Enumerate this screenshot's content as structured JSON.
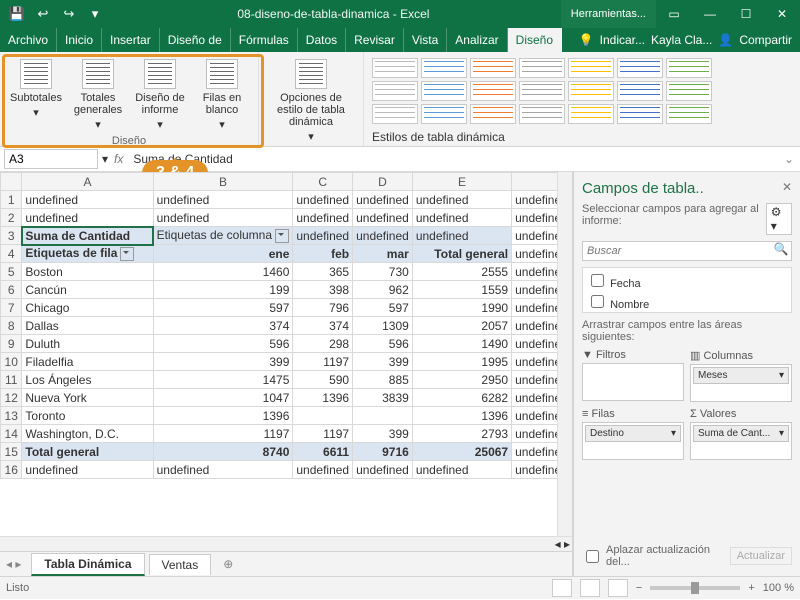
{
  "title": {
    "doc": "08-diseno-de-tabla-dinamica",
    "app": "Excel",
    "tools": "Herramientas..."
  },
  "menu": [
    "Archivo",
    "Inicio",
    "Insertar",
    "Diseño de",
    "Fórmulas",
    "Datos",
    "Revisar",
    "Vista",
    "Analizar",
    "Diseño"
  ],
  "menuActive": 9,
  "tell": "Indicar...",
  "user": "Kayla Cla...",
  "share": "Compartir",
  "ribbon": {
    "g1": {
      "items": [
        "Subtotales",
        "Totales generales",
        "Diseño de informe",
        "Filas en blanco"
      ],
      "label": "Diseño"
    },
    "g2": {
      "items": [
        "Opciones de estilo de tabla dinámica"
      ],
      "label": ""
    },
    "g3": {
      "label": "Estilos de tabla dinámica"
    }
  },
  "callout": "3 & 4",
  "namebox": {
    "ref": "A3",
    "fx": "fx",
    "val": "Suma de Cantidad"
  },
  "cols": [
    "A",
    "B",
    "C",
    "D",
    "E"
  ],
  "pivot": {
    "r3": {
      "a": "Suma de Cantidad",
      "b": "Etiquetas de columna"
    },
    "r4": {
      "a": "Etiquetas de fila",
      "b": "ene",
      "c": "feb",
      "d": "mar",
      "e": "Total general"
    },
    "rows": [
      {
        "n": "5",
        "a": "Boston",
        "b": 1460,
        "c": 365,
        "d": 730,
        "e": 2555
      },
      {
        "n": "6",
        "a": "Cancún",
        "b": 199,
        "c": 398,
        "d": 962,
        "e": 1559
      },
      {
        "n": "7",
        "a": "Chicago",
        "b": 597,
        "c": 796,
        "d": 597,
        "e": 1990
      },
      {
        "n": "8",
        "a": "Dallas",
        "b": 374,
        "c": 374,
        "d": 1309,
        "e": 2057
      },
      {
        "n": "9",
        "a": "Duluth",
        "b": 596,
        "c": 298,
        "d": 596,
        "e": 1490
      },
      {
        "n": "10",
        "a": "Filadelfia",
        "b": 399,
        "c": 1197,
        "d": 399,
        "e": 1995
      },
      {
        "n": "11",
        "a": "Los Ángeles",
        "b": 1475,
        "c": 590,
        "d": 885,
        "e": 2950
      },
      {
        "n": "12",
        "a": "Nueva York",
        "b": 1047,
        "c": 1396,
        "d": 3839,
        "e": 6282
      },
      {
        "n": "13",
        "a": "Toronto",
        "b": 1396,
        "c": "",
        "d": "",
        "e": 1396
      },
      {
        "n": "14",
        "a": "Washington, D.C.",
        "b": 1197,
        "c": 1197,
        "d": 399,
        "e": 2793
      }
    ],
    "total": {
      "n": "15",
      "a": "Total general",
      "b": 8740,
      "c": 6611,
      "d": 9716,
      "e": 25067
    }
  },
  "sheets": {
    "active": "Tabla Dinámica",
    "other": "Ventas"
  },
  "pane": {
    "title": "Campos de tabla..",
    "sub": "Seleccionar campos para agregar al informe:",
    "search": "Buscar",
    "fields": [
      "Fecha",
      "Nombre"
    ],
    "drag": "Arrastrar campos entre las áreas siguientes:",
    "filters": "Filtros",
    "columns": "Columnas",
    "rows": "Filas",
    "values": "Valores",
    "colChip": "Meses",
    "rowChip": "Destino",
    "valChip": "Suma de Cant...",
    "defer": "Aplazar actualización del...",
    "update": "Actualizar"
  },
  "status": {
    "ready": "Listo",
    "zoom": "100 %"
  }
}
